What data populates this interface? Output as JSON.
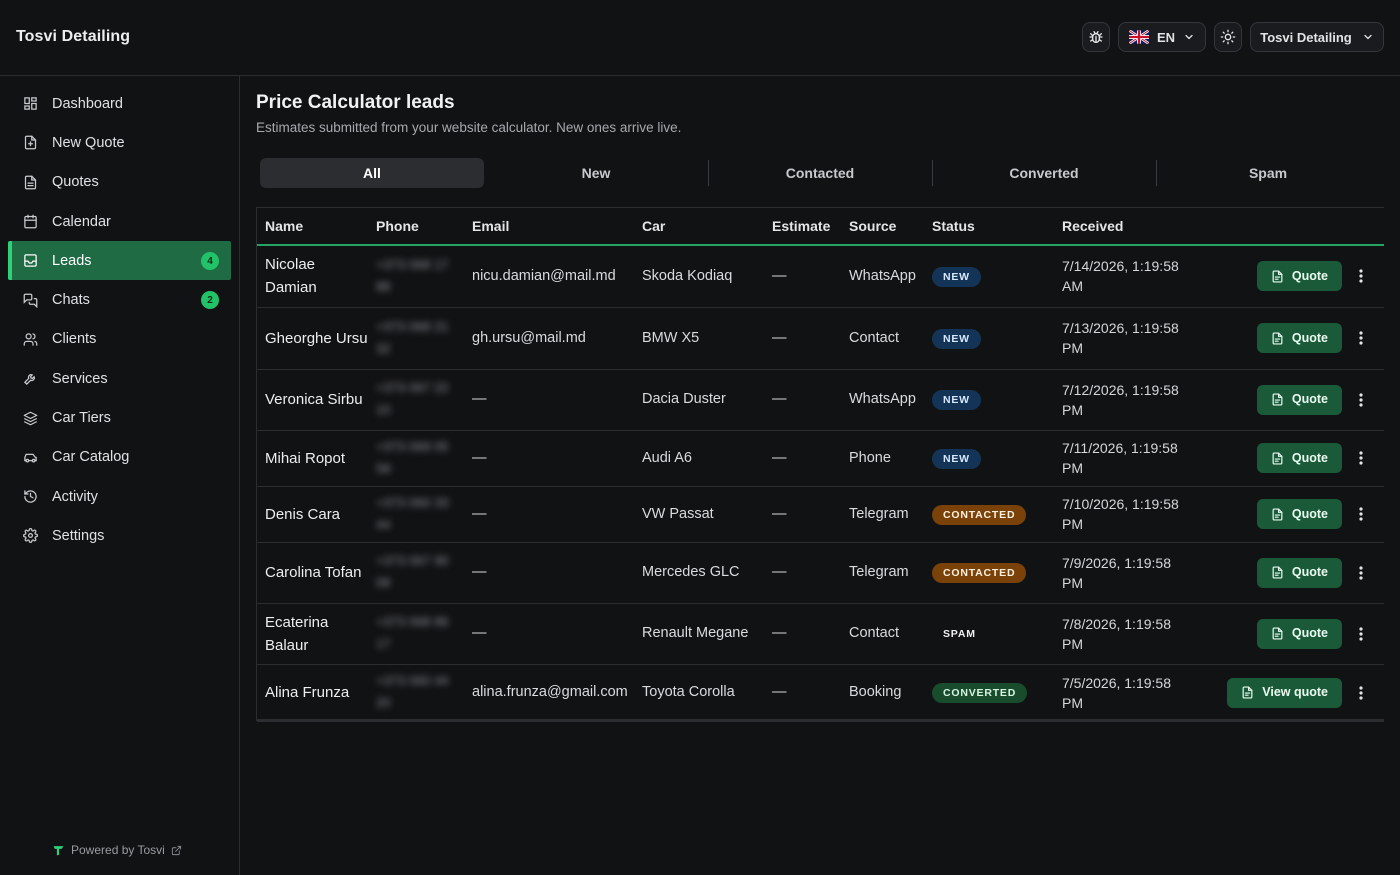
{
  "header": {
    "brand": "Tosvi Detailing",
    "lang": "EN",
    "account": "Tosvi Detailing"
  },
  "sidebar": {
    "items": [
      {
        "label": "Dashboard",
        "icon": "dashboard-icon"
      },
      {
        "label": "New Quote",
        "icon": "file-plus-icon"
      },
      {
        "label": "Quotes",
        "icon": "file-icon"
      },
      {
        "label": "Calendar",
        "icon": "calendar-icon"
      },
      {
        "label": "Leads",
        "icon": "inbox-icon",
        "badge": "4"
      },
      {
        "label": "Chats",
        "icon": "chat-icon",
        "badge": "2"
      },
      {
        "label": "Clients",
        "icon": "users-icon"
      },
      {
        "label": "Services",
        "icon": "wrench-icon"
      },
      {
        "label": "Car Tiers",
        "icon": "layers-icon"
      },
      {
        "label": "Car Catalog",
        "icon": "car-icon"
      },
      {
        "label": "Activity",
        "icon": "history-icon"
      },
      {
        "label": "Settings",
        "icon": "gear-icon"
      }
    ],
    "powered": "Powered by Tosvi"
  },
  "page": {
    "title": "Price Calculator leads",
    "subtitle": "Estimates submitted from your website calculator. New ones arrive live."
  },
  "tabs": [
    "All",
    "New",
    "Contacted",
    "Converted",
    "Spam"
  ],
  "table": {
    "headers": [
      "Name",
      "Phone",
      "Email",
      "Car",
      "Estimate",
      "Source",
      "Status",
      "Received"
    ],
    "rows": [
      {
        "name": "Nicolae Damian",
        "phone": "+373 068 17 88",
        "email": "nicu.damian@mail.md",
        "car": "Skoda Kodiaq",
        "estimate": "—",
        "source": "WhatsApp",
        "status": "NEW",
        "status_kind": "new",
        "received": "7/14/2026, 1:19:58 AM",
        "action": "Quote"
      },
      {
        "name": "Gheorghe Ursu",
        "phone": "+373 068 21 32",
        "email": "gh.ursu@mail.md",
        "car": "BMW X5",
        "estimate": "—",
        "source": "Contact",
        "status": "NEW",
        "status_kind": "new",
        "received": "7/13/2026, 1:19:58 PM",
        "action": "Quote"
      },
      {
        "name": "Veronica Sirbu",
        "phone": "+373 067 22 10",
        "email": "—",
        "car": "Dacia Duster",
        "estimate": "—",
        "source": "WhatsApp",
        "status": "NEW",
        "status_kind": "new",
        "received": "7/12/2026, 1:19:58 PM",
        "action": "Quote"
      },
      {
        "name": "Mihai Ropot",
        "phone": "+373 069 05 58",
        "email": "—",
        "car": "Audi A6",
        "estimate": "—",
        "source": "Phone",
        "status": "NEW",
        "status_kind": "new",
        "received": "7/11/2026, 1:19:58 PM",
        "action": "Quote"
      },
      {
        "name": "Denis Cara",
        "phone": "+373 060 33 44",
        "email": "—",
        "car": "VW Passat",
        "estimate": "—",
        "source": "Telegram",
        "status": "CONTACTED",
        "status_kind": "contacted",
        "received": "7/10/2026, 1:19:58 PM",
        "action": "Quote"
      },
      {
        "name": "Carolina Tofan",
        "phone": "+373 067 90 08",
        "email": "—",
        "car": "Mercedes GLC",
        "estimate": "—",
        "source": "Telegram",
        "status": "CONTACTED",
        "status_kind": "contacted",
        "received": "7/9/2026, 1:19:58 PM",
        "action": "Quote"
      },
      {
        "name": "Ecaterina Balaur",
        "phone": "+373 068 86 17",
        "email": "—",
        "car": "Renault Megane",
        "estimate": "—",
        "source": "Contact",
        "status": "SPAM",
        "status_kind": "spam",
        "received": "7/8/2026, 1:19:58 PM",
        "action": "Quote"
      },
      {
        "name": "Alina Frunza",
        "phone": "+373 060 44 20",
        "email": "alina.frunza@gmail.com",
        "car": "Toyota Corolla",
        "estimate": "—",
        "source": "Booking",
        "status": "CONVERTED",
        "status_kind": "converted",
        "received": "7/5/2026, 1:19:58 PM",
        "action": "View quote"
      }
    ]
  },
  "colors": {
    "accent": "#1f6b43",
    "accent_bright": "#2fd07a",
    "badge": "#22c269",
    "new": "#143457",
    "contacted": "#7a4209",
    "converted": "#194b2d"
  }
}
